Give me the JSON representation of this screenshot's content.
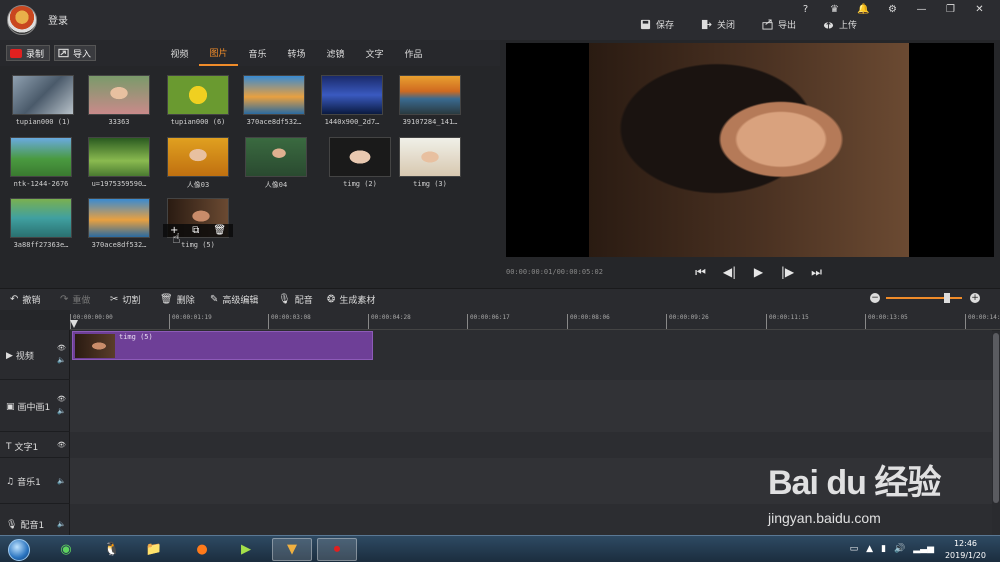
{
  "title_bar": {
    "login_label": "登录",
    "actions": [
      {
        "label": "保存",
        "icon": "save-icon"
      },
      {
        "label": "关闭",
        "icon": "close-project-icon"
      },
      {
        "label": "导出",
        "icon": "export-icon"
      },
      {
        "label": "上传",
        "icon": "upload-icon"
      }
    ]
  },
  "media_toolbar": {
    "record_label": "录制",
    "import_label": "导入",
    "tabs": [
      {
        "label": "视频",
        "active": false
      },
      {
        "label": "图片",
        "active": true
      },
      {
        "label": "音乐",
        "active": false
      },
      {
        "label": "转场",
        "active": false
      },
      {
        "label": "滤镜",
        "active": false
      },
      {
        "label": "文字",
        "active": false
      },
      {
        "label": "作品",
        "active": false
      }
    ],
    "accent_color": "#f08c2a"
  },
  "library": {
    "items": [
      {
        "caption": "tupian000 (1)"
      },
      {
        "caption": "33363"
      },
      {
        "caption": "tupian000 (6)"
      },
      {
        "caption": "370ace8df532…"
      },
      {
        "caption": "1440x900_2d7…"
      },
      {
        "caption": "39107284_141…"
      },
      {
        "caption": "ntk-1244-2676"
      },
      {
        "caption": "u=1975359590…"
      },
      {
        "caption": "人像03"
      },
      {
        "caption": "人像04"
      },
      {
        "caption": "timg (2)"
      },
      {
        "caption": "timg (3)"
      },
      {
        "caption": "3a88ff27363e…"
      },
      {
        "caption": "370ace8df532…"
      },
      {
        "caption": "timg (5)"
      }
    ]
  },
  "preview": {
    "timecode": "00:00:00:01/00:00:05:02"
  },
  "edit_toolbar": {
    "undo": "撤销",
    "redo": "重做",
    "cut": "切割",
    "delete": "删除",
    "advanced_edit": "高级编辑",
    "dubbing": "配音",
    "generate": "生成素材",
    "zoom_level": 0.8
  },
  "timeline": {
    "ruler_ticks": [
      "00:00:00:00",
      "00:00:01:19",
      "00:00:03:08",
      "00:00:04:28",
      "00:00:06:17",
      "00:00:08:06",
      "00:00:09:26",
      "00:00:11:15",
      "00:00:13:05",
      "00:00:14:"
    ],
    "tracks": [
      {
        "label": "视频",
        "icon": "video-track-icon"
      },
      {
        "label": "画中画1",
        "icon": "pip-track-icon"
      },
      {
        "label": "文字1",
        "icon": "text-track-icon"
      },
      {
        "label": "音乐1",
        "icon": "music-track-icon"
      },
      {
        "label": "配音1",
        "icon": "mic-track-icon"
      }
    ],
    "clip_label": "timg (5)",
    "clip_color": "#6e3f97"
  },
  "taskbar": {
    "time": "12:46",
    "date": "2019/1/20"
  },
  "watermark": {
    "logo": "Bai du 经验",
    "url": "jingyan.baidu.com"
  }
}
